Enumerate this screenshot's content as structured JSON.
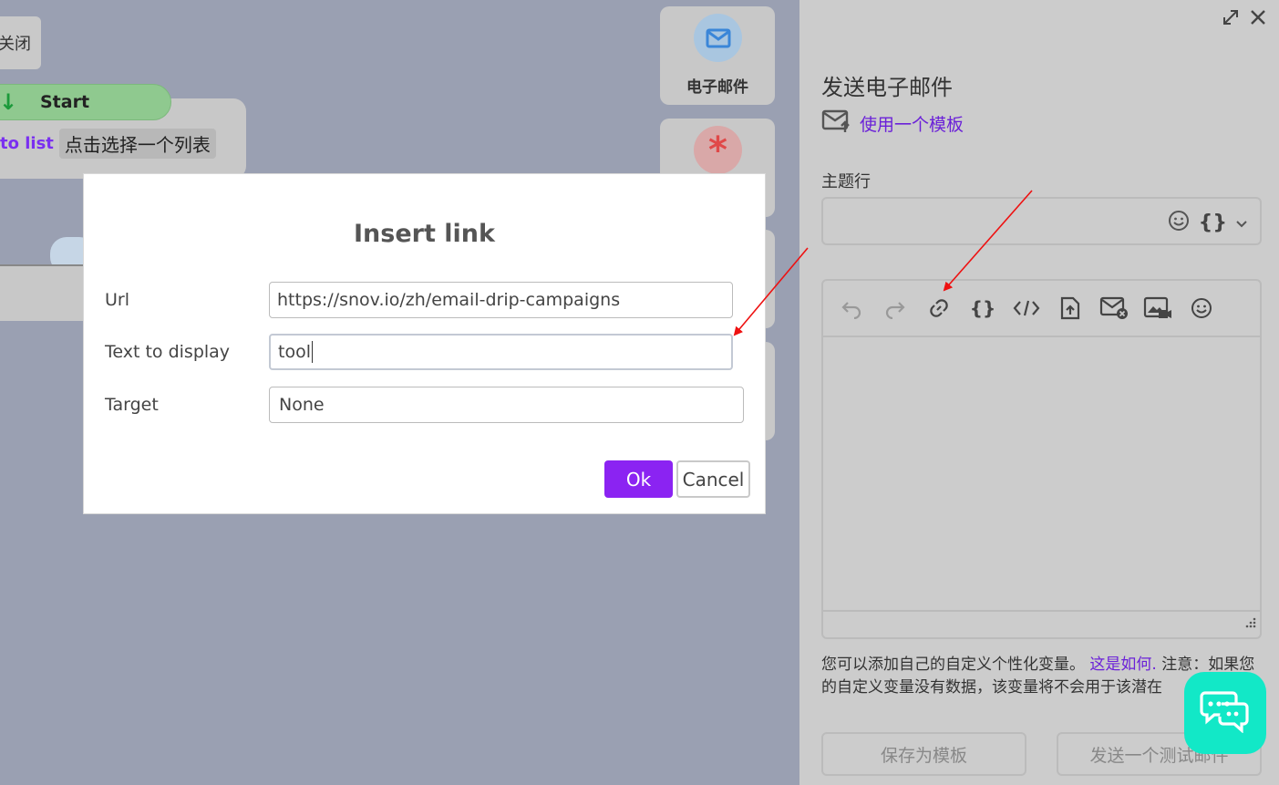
{
  "canvas": {
    "close_chip_label": "关闭",
    "start_label": "Start",
    "list_link": "to list",
    "list_pick": "点击选择一个列表",
    "email_tile_label": "电子邮件"
  },
  "panel": {
    "title": "发送电子邮件",
    "template_link": "使用一个模板",
    "subject_label": "主题行",
    "subject_braces": "{}",
    "toolbar_braces": "{}",
    "help_text_1": "您可以添加自己的自定义个性化变量。",
    "help_link": "这是如何.",
    "help_text_2": "注意：如果您的自定义变量没有数据，该变量将不会用于该潜在",
    "save_template_label": "保存为模板",
    "send_test_label": "发送一个测试邮件"
  },
  "modal": {
    "title": "Insert link",
    "url_label": "Url",
    "url_value": "https://snov.io/zh/email-drip-campaigns",
    "text_label": "Text to display",
    "text_value": "tool",
    "target_label": "Target",
    "target_value": "None",
    "ok_label": "Ok",
    "cancel_label": "Cancel"
  },
  "colors": {
    "accent": "#8b23f2",
    "link": "#6b21d8",
    "chat": "#12e8c7",
    "annotation_arrow": "#ee1111"
  }
}
